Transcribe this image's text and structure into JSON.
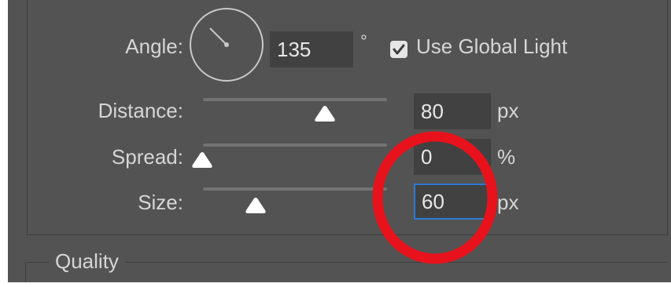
{
  "angle": {
    "label": "Angle:",
    "value": "135",
    "unit": "°",
    "use_global_light": {
      "label": "Use Global Light",
      "checked": true
    }
  },
  "distance": {
    "label": "Distance:",
    "value": "80",
    "unit": "px",
    "slider_fraction": 0.63
  },
  "spread": {
    "label": "Spread:",
    "value": "0",
    "unit": "%",
    "slider_fraction": 0.0
  },
  "size": {
    "label": "Size:",
    "value": "60",
    "unit": "px",
    "slider_fraction": 0.28
  },
  "quality": {
    "label": "Quality"
  },
  "colors": {
    "panel_bg": "#535353",
    "field_bg": "#414141",
    "focus_border": "#2b7bd6",
    "annotation": "#e8121c"
  },
  "icons": {
    "angle_dial": "angle-dial-icon",
    "checkmark": "checkmark-icon",
    "slider_thumb": "triangle-slider-thumb",
    "annotation": "red-circle-annotation"
  }
}
